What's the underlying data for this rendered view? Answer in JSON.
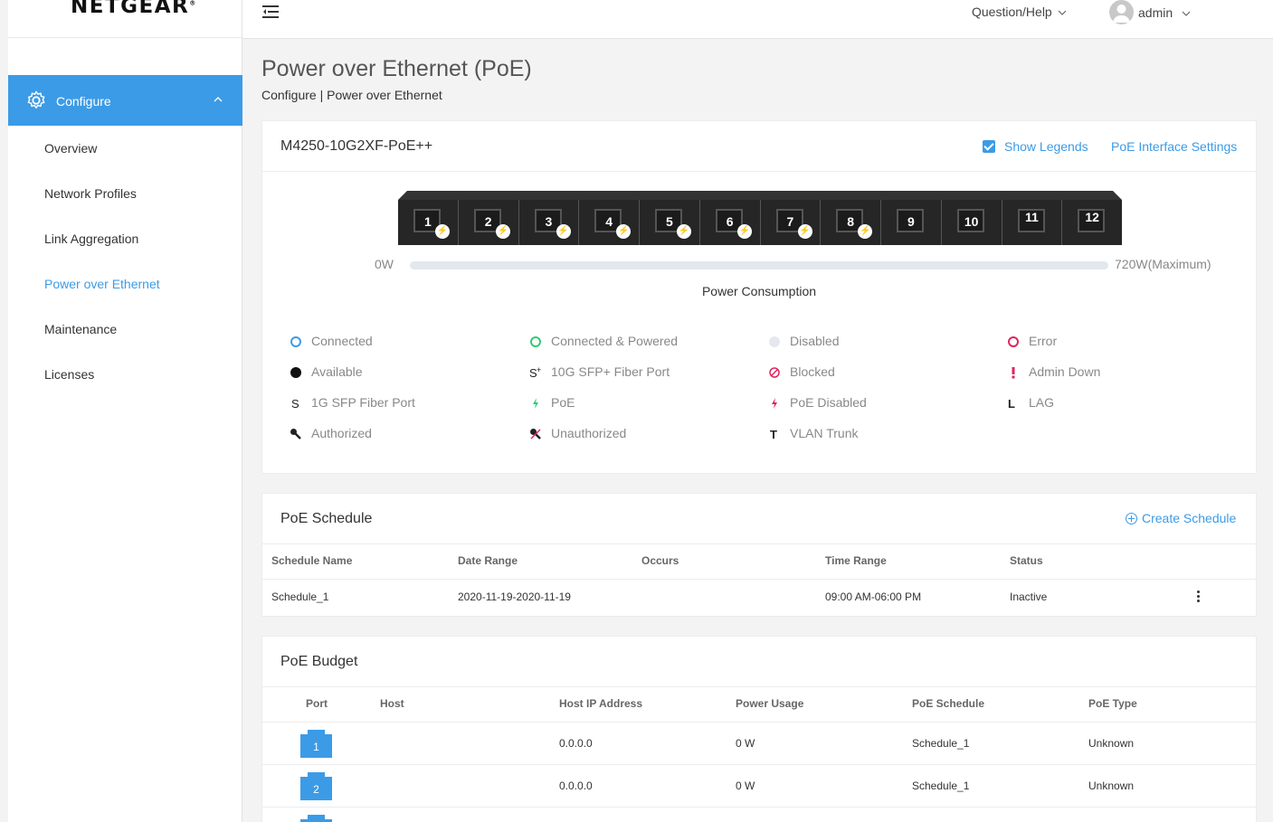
{
  "brand": {
    "name": "NETGEAR",
    "mark": "®"
  },
  "sidebar": {
    "section": "Configure",
    "items": [
      {
        "label": "Overview"
      },
      {
        "label": "Network Profiles"
      },
      {
        "label": "Link Aggregation"
      },
      {
        "label": "Power over Ethernet",
        "active": true
      },
      {
        "label": "Maintenance"
      },
      {
        "label": "Licenses"
      }
    ]
  },
  "topbar": {
    "help": "Question/Help",
    "user": "admin"
  },
  "page": {
    "title": "Power over Ethernet (PoE)",
    "breadcrumb": "Configure | Power over Ethernet"
  },
  "device": {
    "model": "M4250-10G2XF-PoE++",
    "show_legends": "Show Legends",
    "interface_settings": "PoE Interface Settings",
    "ports": [
      "1",
      "2",
      "3",
      "4",
      "5",
      "6",
      "7",
      "8",
      "9",
      "10",
      "11",
      "12"
    ],
    "poe_ports": [
      "1",
      "2",
      "3",
      "4",
      "5",
      "6",
      "7",
      "8"
    ],
    "power_min": "0W",
    "power_max": "720W(Maximum)",
    "power_label": "Power Consumption",
    "power_used_fraction": 0
  },
  "legends": [
    {
      "icon": "connected-icon",
      "label": "Connected"
    },
    {
      "icon": "connected-powered-icon",
      "label": "Connected & Powered"
    },
    {
      "icon": "disabled-icon",
      "label": "Disabled"
    },
    {
      "icon": "error-icon",
      "label": "Error"
    },
    {
      "icon": "available-icon",
      "label": "Available"
    },
    {
      "icon": "sfp-plus-icon",
      "label": "10G SFP+ Fiber Port"
    },
    {
      "icon": "blocked-icon",
      "label": "Blocked"
    },
    {
      "icon": "admin-down-icon",
      "label": "Admin Down"
    },
    {
      "icon": "sfp-icon",
      "label": "1G SFP Fiber Port"
    },
    {
      "icon": "poe-icon",
      "label": "PoE"
    },
    {
      "icon": "poe-disabled-icon",
      "label": "PoE Disabled"
    },
    {
      "icon": "lag-icon",
      "label": "LAG"
    },
    {
      "icon": "authorized-icon",
      "label": "Authorized"
    },
    {
      "icon": "unauthorized-icon",
      "label": "Unauthorized"
    },
    {
      "icon": "vlan-trunk-icon",
      "label": "VLAN Trunk"
    }
  ],
  "schedule": {
    "title": "PoE Schedule",
    "create": "Create Schedule",
    "headers": [
      "Schedule Name",
      "Date Range",
      "Occurs",
      "Time Range",
      "Status"
    ],
    "rows": [
      {
        "name": "Schedule_1",
        "date_range": "2020-11-19-2020-11-19",
        "occurs": "",
        "time_range": "09:00 AM-06:00 PM",
        "status": "Inactive"
      }
    ]
  },
  "budget": {
    "title": "PoE Budget",
    "headers": [
      "Port",
      "Host",
      "Host IP Address",
      "Power Usage",
      "PoE Schedule",
      "PoE Type"
    ],
    "rows": [
      {
        "port": "1",
        "host": "",
        "ip": "0.0.0.0",
        "power": "0 W",
        "schedule": "Schedule_1",
        "type": "Unknown"
      },
      {
        "port": "2",
        "host": "",
        "ip": "0.0.0.0",
        "power": "0 W",
        "schedule": "Schedule_1",
        "type": "Unknown"
      }
    ]
  },
  "colors": {
    "accent": "#3c9be6",
    "poe": "#2ecc71",
    "error": "#e0245e"
  }
}
